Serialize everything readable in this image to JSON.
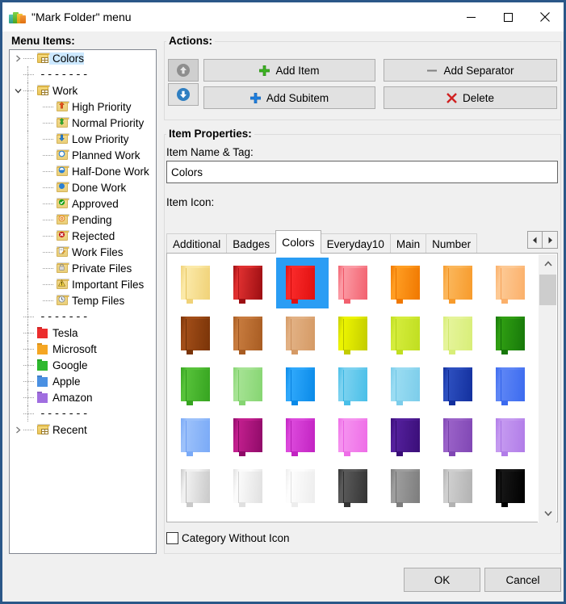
{
  "window": {
    "title": "\"Mark Folder\" menu",
    "icon": "app-folders-icon",
    "minimize": "minimize-icon",
    "maximize": "maximize-icon",
    "close": "close-icon"
  },
  "tree_panel": {
    "label": "Menu Items:",
    "items": [
      {
        "label": "Colors",
        "depth": 0,
        "expander": "collapsed",
        "icon": "folder-category-icon",
        "icon_color": "#f6d97a",
        "selected": true
      },
      {
        "label": "-------",
        "depth": 0,
        "expander": "none",
        "icon": "separator",
        "selected": false
      },
      {
        "label": "Work",
        "depth": 0,
        "expander": "expanded",
        "icon": "folder-category-icon",
        "icon_color": "#f6d97a",
        "selected": false
      },
      {
        "label": "High Priority",
        "depth": 1,
        "expander": "none",
        "icon": "arrow-up-red-icon",
        "icon_color": "#f3d98b",
        "selected": false
      },
      {
        "label": "Normal Priority",
        "depth": 1,
        "expander": "none",
        "icon": "arrow-updown-green-icon",
        "icon_color": "#f3d98b",
        "selected": false
      },
      {
        "label": "Low Priority",
        "depth": 1,
        "expander": "none",
        "icon": "arrow-down-blue-icon",
        "icon_color": "#f3d98b",
        "selected": false
      },
      {
        "label": "Planned Work",
        "depth": 1,
        "expander": "none",
        "icon": "circle-empty-blue-icon",
        "icon_color": "#f3d98b",
        "selected": false
      },
      {
        "label": "Half-Done Work",
        "depth": 1,
        "expander": "none",
        "icon": "circle-half-blue-icon",
        "icon_color": "#f3d98b",
        "selected": false
      },
      {
        "label": "Done Work",
        "depth": 1,
        "expander": "none",
        "icon": "circle-full-blue-icon",
        "icon_color": "#f3d98b",
        "selected": false
      },
      {
        "label": "Approved",
        "depth": 1,
        "expander": "none",
        "icon": "check-green-icon",
        "icon_color": "#f3d98b",
        "selected": false
      },
      {
        "label": "Pending",
        "depth": 1,
        "expander": "none",
        "icon": "pending-orange-icon",
        "icon_color": "#f3d98b",
        "selected": false
      },
      {
        "label": "Rejected",
        "depth": 1,
        "expander": "none",
        "icon": "cross-red-icon",
        "icon_color": "#f3d98b",
        "selected": false
      },
      {
        "label": "Work Files",
        "depth": 1,
        "expander": "none",
        "icon": "document-pencil-icon",
        "icon_color": "#f3d98b",
        "selected": false
      },
      {
        "label": "Private Files",
        "depth": 1,
        "expander": "none",
        "icon": "lock-icon",
        "icon_color": "#f3d98b",
        "selected": false
      },
      {
        "label": "Important Files",
        "depth": 1,
        "expander": "none",
        "icon": "warning-triangle-icon",
        "icon_color": "#f3d98b",
        "selected": false
      },
      {
        "label": "Temp Files",
        "depth": 1,
        "expander": "none",
        "icon": "clock-icon",
        "icon_color": "#f3d98b",
        "selected": false
      },
      {
        "label": "-------",
        "depth": 0,
        "expander": "none",
        "icon": "separator",
        "selected": false
      },
      {
        "label": "Tesla",
        "depth": 0,
        "expander": "none",
        "icon": "folder-solid-icon",
        "icon_color": "#ec2d2d",
        "selected": false
      },
      {
        "label": "Microsoft",
        "depth": 0,
        "expander": "none",
        "icon": "folder-solid-icon",
        "icon_color": "#f5a623",
        "selected": false
      },
      {
        "label": "Google",
        "depth": 0,
        "expander": "none",
        "icon": "folder-solid-icon",
        "icon_color": "#2eb82e",
        "selected": false
      },
      {
        "label": "Apple",
        "depth": 0,
        "expander": "none",
        "icon": "folder-solid-icon",
        "icon_color": "#4a90e2",
        "selected": false
      },
      {
        "label": "Amazon",
        "depth": 0,
        "expander": "none",
        "icon": "folder-solid-icon",
        "icon_color": "#a06ee0",
        "selected": false
      },
      {
        "label": "-------",
        "depth": 0,
        "expander": "none",
        "icon": "separator",
        "selected": false
      },
      {
        "label": "Recent",
        "depth": 0,
        "expander": "collapsed",
        "icon": "folder-category-icon",
        "icon_color": "#f6d97a",
        "selected": false
      }
    ]
  },
  "actions": {
    "label": "Actions:",
    "move_up": {
      "name": "move-up-button",
      "enabled": false
    },
    "move_down": {
      "name": "move-down-button",
      "enabled": true
    },
    "add_item": "Add Item",
    "add_subitem": "Add Subitem",
    "add_separator": "Add Separator",
    "delete": "Delete"
  },
  "item_properties": {
    "label": "Item Properties:",
    "name_tag_label": "Item Name & Tag:",
    "name_tag_value": "Colors",
    "name_tag_placeholder": "",
    "item_icon_label": "Item Icon:",
    "tabs": [
      {
        "label": "Additional",
        "active": false
      },
      {
        "label": "Badges",
        "active": false
      },
      {
        "label": "Colors",
        "active": true
      },
      {
        "label": "Everyday10",
        "active": false
      },
      {
        "label": "Main",
        "active": false
      },
      {
        "label": "Number",
        "active": false
      }
    ],
    "tab_scroll_left": "scroll-left-icon",
    "tab_scroll_right": "scroll-right-icon",
    "icon_grid": {
      "columns": 7,
      "selected_index": 2,
      "swatches": [
        {
          "light": "#fbe9a8",
          "dark": "#f0d278",
          "edge": "#e7c45f"
        },
        {
          "light": "#e03030",
          "dark": "#9c0e12",
          "edge": "#b21418"
        },
        {
          "light": "#fa2a2a",
          "dark": "#e01010",
          "edge": "#d00c0c"
        },
        {
          "light": "#fb9aa4",
          "dark": "#f2616f",
          "edge": "#ef5566"
        },
        {
          "light": "#ff9d22",
          "dark": "#f07800",
          "edge": "#e87200"
        },
        {
          "light": "#fbb65a",
          "dark": "#f79b2c",
          "edge": "#ef9020"
        },
        {
          "light": "#fdc994",
          "dark": "#fbb06a",
          "edge": "#f7a258"
        },
        {
          "light": "#a14d18",
          "dark": "#7a3408",
          "edge": "#6e2f06"
        },
        {
          "light": "#c77b3e",
          "dark": "#a85c22",
          "edge": "#9c5420"
        },
        {
          "light": "#e2b184",
          "dark": "#d59a65",
          "edge": "#cb8f5c"
        },
        {
          "light": "#ecf400",
          "dark": "#c3cc00",
          "edge": "#b6bf00"
        },
        {
          "light": "#d4ec3c",
          "dark": "#c0de20",
          "edge": "#b4d31a"
        },
        {
          "light": "#e5f49a",
          "dark": "#d8ee78",
          "edge": "#cfe86b"
        },
        {
          "light": "#2f9e12",
          "dark": "#17780a",
          "edge": "#126c08"
        },
        {
          "light": "#57c23a",
          "dark": "#36a420",
          "edge": "#2f991b"
        },
        {
          "light": "#a6e394",
          "dark": "#86d572",
          "edge": "#7bcd66"
        },
        {
          "light": "#2fa8fb",
          "dark": "#0a8ae8",
          "edge": "#0880dd"
        },
        {
          "light": "#7dd2f0",
          "dark": "#49bfe8",
          "edge": "#3cb6e2"
        },
        {
          "light": "#9adcf2",
          "dark": "#7ccdea",
          "edge": "#6fc6e6"
        },
        {
          "light": "#2d4fbf",
          "dark": "#13309e",
          "edge": "#102a92"
        },
        {
          "light": "#5e86f5",
          "dark": "#3c6bef",
          "edge": "#3062e9"
        },
        {
          "light": "#9cc1fa",
          "dark": "#7aaaf7",
          "edge": "#6e9ff4"
        },
        {
          "light": "#c21f8e",
          "dark": "#8f0a68",
          "edge": "#81095e"
        },
        {
          "light": "#dc49dc",
          "dark": "#c223c2",
          "edge": "#b41fb4"
        },
        {
          "light": "#f592ef",
          "dark": "#ee6de7",
          "edge": "#e961e2"
        },
        {
          "light": "#54209c",
          "dark": "#3a0e78",
          "edge": "#330c6d"
        },
        {
          "light": "#9a62c8",
          "dark": "#8047b4",
          "edge": "#7640a9"
        },
        {
          "light": "#c59af0",
          "dark": "#b17ce8",
          "edge": "#a872e3"
        },
        {
          "light": "#f1f1f1",
          "dark": "#c9c9c9",
          "edge": "#bdbdbd"
        },
        {
          "light": "#fbfbfb",
          "dark": "#e0e0e0",
          "edge": "#d4d4d4"
        },
        {
          "light": "#fdfdfd",
          "dark": "#ededed",
          "edge": "#e2e2e2"
        },
        {
          "light": "#5a5a5a",
          "dark": "#343434",
          "edge": "#2c2c2c"
        },
        {
          "light": "#9e9e9e",
          "dark": "#7d7d7d",
          "edge": "#727272"
        },
        {
          "light": "#cfcfcf",
          "dark": "#b2b2b2",
          "edge": "#a6a6a6"
        },
        {
          "light": "#171717",
          "dark": "#000000",
          "edge": "#000000"
        }
      ]
    },
    "scrollbar": {
      "up": "scroll-up-icon",
      "down": "scroll-down-icon"
    }
  },
  "category_checkbox": {
    "label": "Category Without Icon",
    "checked": false
  },
  "footer": {
    "ok": "OK",
    "cancel": "Cancel"
  },
  "colors": {
    "window_border": "#2b5788",
    "dialog_bg": "#f0f0f0",
    "selection": "#cce8ff",
    "grid_selection": "#2a9df4"
  }
}
